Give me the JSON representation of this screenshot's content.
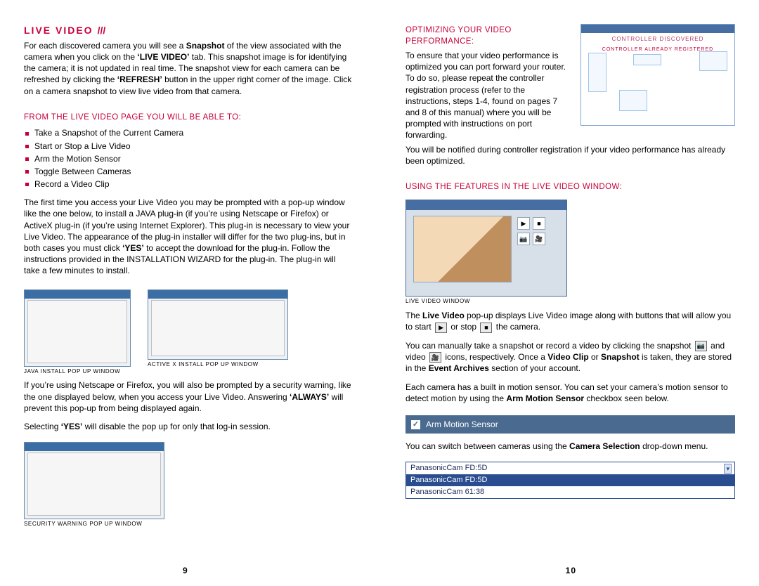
{
  "left": {
    "title": "LIVE VIDEO",
    "title_slashes": "///",
    "intro_html": "For each discovered camera you will see a <b>Snapshot</b> of the view associated with the camera when you click on the <b>‘LIVE VIDEO’</b> tab. This snapshot image is for identifying the camera; it is not updated in real time. The snapshot view for each camera can be refreshed by clicking the <b>‘REFRESH’</b> button in the upper right corner of the image. Click on a camera snapshot to view live video from that camera.",
    "sub1": "FROM THE LIVE VIDEO PAGE YOU WILL BE ABLE TO:",
    "features": [
      "Take a Snapshot of the Current Camera",
      "Start or Stop a Live Video",
      "Arm the Motion Sensor",
      "Toggle Between Cameras",
      "Record a Video Clip"
    ],
    "plugin_para_html": "The first time you access your Live Video you may be prompted with a pop-up window like the one below, to install a JAVA plug-in (if you’re using Netscape or Firefox) or ActiveX plug-in (if you’re using Internet Explorer). This plug-in is necessary to view your Live Video. The appearance of the plug-in installer will differ for the two plug-ins, but in both cases you must click <b>‘YES’</b> to accept the download for the plug-in. Follow the instructions provided in the INSTALLATION WIZARD for the plug-in. The plug-in will take a few minutes to install.",
    "cap_java": "JAVA INSTALL POP UP WINDOW",
    "cap_activex": "ACTIVE X INSTALL POP UP WINDOW",
    "warn_para_html": "If you’re using Netscape or Firefox, you will also be prompted by a security warning, like the one displayed below, when you access your Live Video. Answering <b>‘ALWAYS’</b> will prevent this pop-up from being displayed again.",
    "yes_para_html": "Selecting <b>‘YES’</b> will disable the pop up for only that log-in session.",
    "cap_security": "SECURITY WARNING POP UP WINDOW",
    "page_no": "9"
  },
  "right": {
    "sub1": "OPTIMIZING YOUR VIDEO PERFORMANCE:",
    "router_msg1": "CONTROLLER DISCOVERED",
    "router_msg2": "CONTROLLER ALREADY REGISTERED",
    "opt_para1": "To ensure that your video performance is optimized you can port forward your router. To do so, please repeat the controller registration process (refer to the instructions, steps 1-4, found on pages 7 and 8 of this manual) where you will be prompted with instructions on port forwarding.",
    "opt_para2": "You will be notified during controller registration if your video performance has already been optimized.",
    "sub2": "USING THE FEATURES IN THE LIVE VIDEO WINDOW:",
    "cap_live": "LIVE VIDEO WINDOW",
    "lv_para_html": "The <b>Live Video</b> pop-up displays Live Video image along with buttons that will allow you to start",
    "lv_mid": "or stop",
    "lv_end": "the camera.",
    "snap_para_html1": "You can manually take a snapshot or record a video by clicking the snapshot",
    "snap_and": "and",
    "snap_para_html2_pre": "video",
    "snap_para_html2_post": "icons, respectively. Once a <b>Video Clip</b> or <b>Snapshot</b> is taken, they are stored in the <b>Event Archives</b> section of your account.",
    "motion_para_html": "Each camera has a built in motion sensor. You can set your camera’s motion sensor to detect motion by using the <b>Arm Motion Sensor</b> checkbox seen below.",
    "arm_label": "Arm Motion Sensor",
    "switch_para_html": "You can switch between cameras using the <b>Camera Selection</b> drop-down menu.",
    "dropdown": {
      "selected": "PanasonicCam FD:5D",
      "opt1": "PanasonicCam FD:5D",
      "opt2": "PanasonicCam 61:38"
    },
    "page_no": "10"
  }
}
